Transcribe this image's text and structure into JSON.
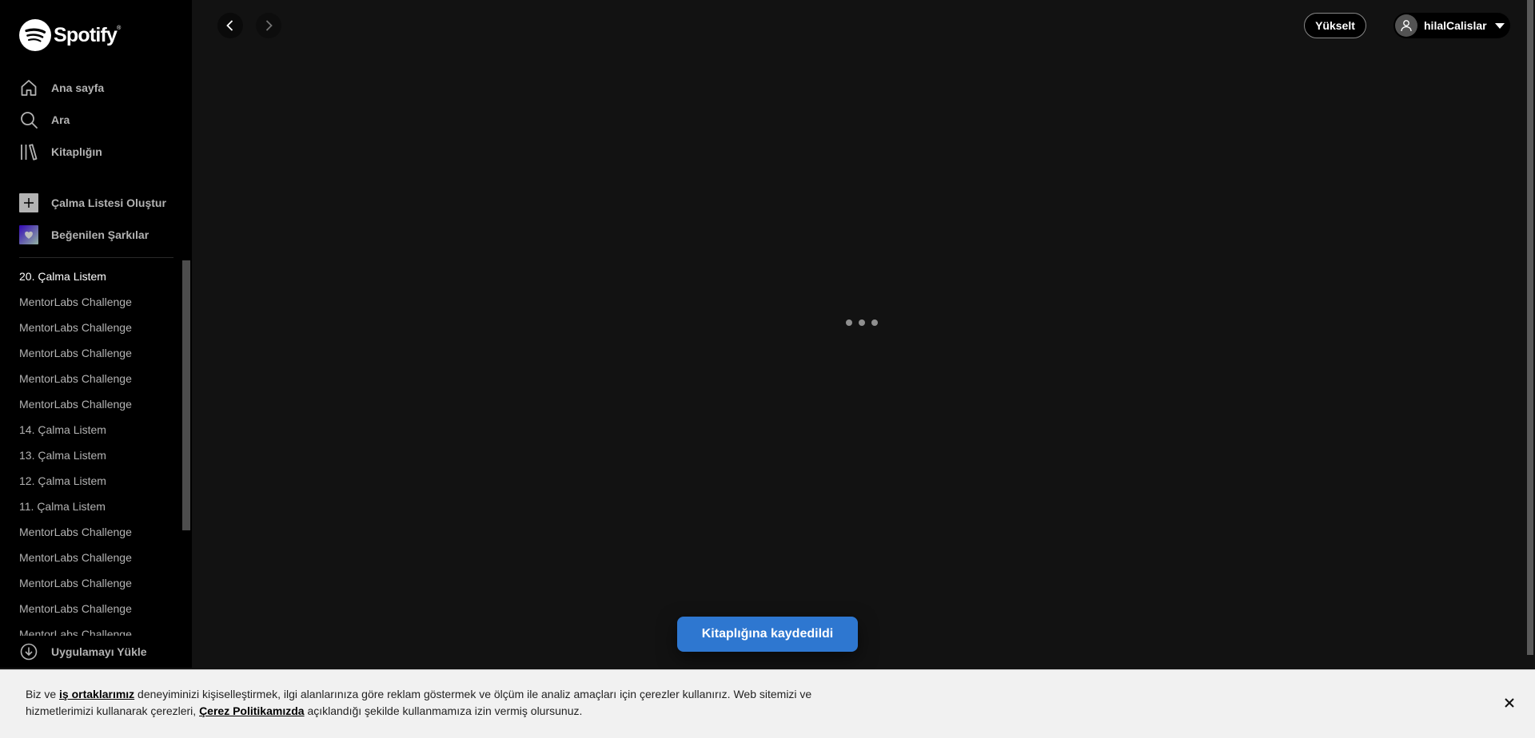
{
  "app": {
    "brand": "Spotify",
    "trademark": "®"
  },
  "nav": [
    {
      "label": "Ana sayfa",
      "icon": "home-icon"
    },
    {
      "label": "Ara",
      "icon": "search-icon"
    },
    {
      "label": "Kitaplığın",
      "icon": "library-icon"
    }
  ],
  "actions": {
    "create_playlist": "Çalma Listesi Oluştur",
    "liked_songs": "Beğenilen Şarkılar"
  },
  "playlists": [
    "20. Çalma Listem",
    "MentorLabs Challenge",
    "MentorLabs Challenge",
    "MentorLabs Challenge",
    "MentorLabs Challenge",
    "MentorLabs Challenge",
    "14. Çalma Listem",
    "13. Çalma Listem",
    "12. Çalma Listem",
    "11. Çalma Listem",
    "MentorLabs Challenge",
    "MentorLabs Challenge",
    "MentorLabs Challenge",
    "MentorLabs Challenge",
    "MentorLabs Challenge"
  ],
  "install_app": "Uygulamayı Yükle",
  "topbar": {
    "upgrade": "Yükselt",
    "username": "hilalCalislar"
  },
  "toast": "Kitaplığına kaydedildi",
  "cookie": {
    "t1": "Biz ve ",
    "link1": "iş ortaklarımız",
    "t2": " deneyiminizi kişiselleştirmek, ilgi alanlarınıza göre reklam göstermek ve ölçüm ile analiz amaçları için çerezler kullanırız. Web sitemizi ve hizmetlerimizi kullanarak çerezleri, ",
    "link2": "Çerez Politikamızda",
    "t3": " açıklandığı şekilde kullanmamıza izin vermiş olursunuz."
  },
  "colors": {
    "accent": "#1db954",
    "toast": "#2e77d0",
    "sidebar": "#000000",
    "main": "#121212"
  }
}
